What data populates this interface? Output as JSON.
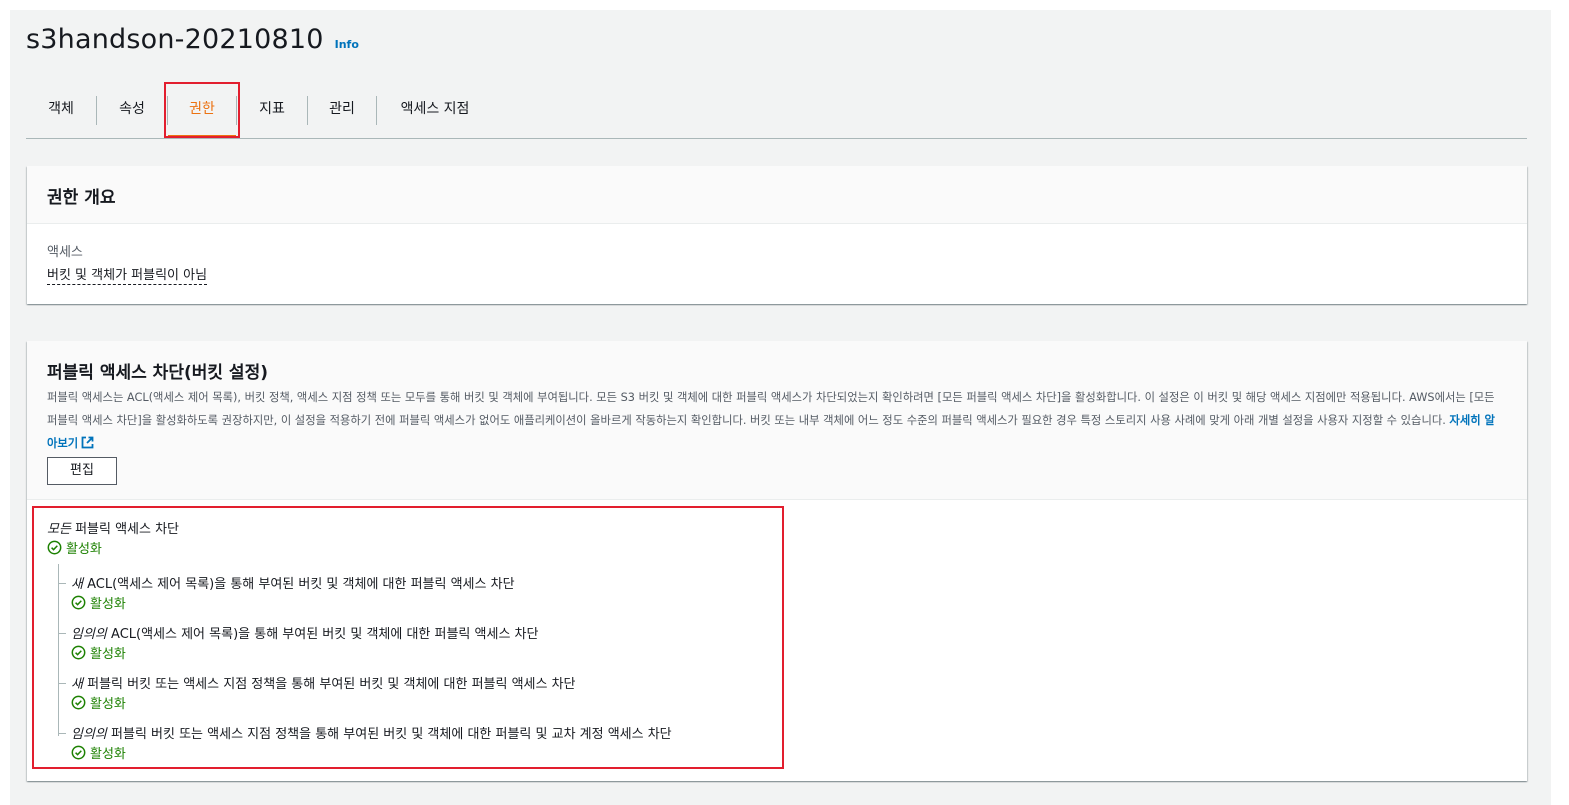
{
  "header": {
    "title": "s3handson-20210810",
    "info_label": "Info"
  },
  "tabs": [
    {
      "label": "객체"
    },
    {
      "label": "속성"
    },
    {
      "label": "권한",
      "active": true
    },
    {
      "label": "지표"
    },
    {
      "label": "관리"
    },
    {
      "label": "액세스 지점"
    }
  ],
  "overview": {
    "title": "권한 개요",
    "access_label": "액세스",
    "access_value": "버킷 및 객체가 퍼블릭이 아님"
  },
  "block_public_access": {
    "title": "퍼블릭 액세스 차단(버킷 설정)",
    "description": "퍼블릭 액세스는 ACL(액세스 제어 목록), 버킷 정책, 액세스 지점 정책 또는 모두를 통해 버킷 및 객체에 부여됩니다. 모든 S3 버킷 및 객체에 대한 퍼블릭 액세스가 차단되었는지 확인하려면 [모든 퍼블릭 액세스 차단]을 활성화합니다. 이 설정은 이 버킷 및 해당 액세스 지점에만 적용됩니다. AWS에서는 [모든 퍼블릭 액세스 차단]을 활성화하도록 권장하지만, 이 설정을 적용하기 전에 퍼블릭 액세스가 없어도 애플리케이션이 올바르게 작동하는지 확인합니다. 버킷 또는 내부 객체에 어느 정도 수준의 퍼블릭 액세스가 필요한 경우 특정 스토리지 사용 사례에 맞게 아래 개별 설정을 사용자 지정할 수 있습니다.",
    "learn_more": "자세히 알아보기",
    "edit_label": "편집",
    "main_setting": {
      "emphasis": "모든",
      "label": "퍼블릭 액세스 차단",
      "status": "활성화"
    },
    "sub_settings": [
      {
        "emphasis": "새",
        "label": "ACL(액세스 제어 목록)을 통해 부여된 버킷 및 객체에 대한 퍼블릭 액세스 차단",
        "status": "활성화"
      },
      {
        "emphasis": "임의의",
        "label": "ACL(액세스 제어 목록)을 통해 부여된 버킷 및 객체에 대한 퍼블릭 액세스 차단",
        "status": "활성화"
      },
      {
        "emphasis": "새",
        "label": "퍼블릭 버킷 또는 액세스 지점 정책을 통해 부여된 버킷 및 객체에 대한 퍼블릭 액세스 차단",
        "status": "활성화"
      },
      {
        "emphasis": "임의의",
        "label": "퍼블릭 버킷 또는 액세스 지점 정책을 통해 부여된 버킷 및 객체에 대한 퍼블릭 및 교차 계정 액세스 차단",
        "status": "활성화"
      }
    ]
  },
  "colors": {
    "accent_tab": "#ec7211",
    "link": "#0073bb",
    "success": "#1d8102",
    "highlight_box": "#e21e2e"
  },
  "icons": {
    "status": "check-circle-icon",
    "external": "external-link-icon"
  }
}
